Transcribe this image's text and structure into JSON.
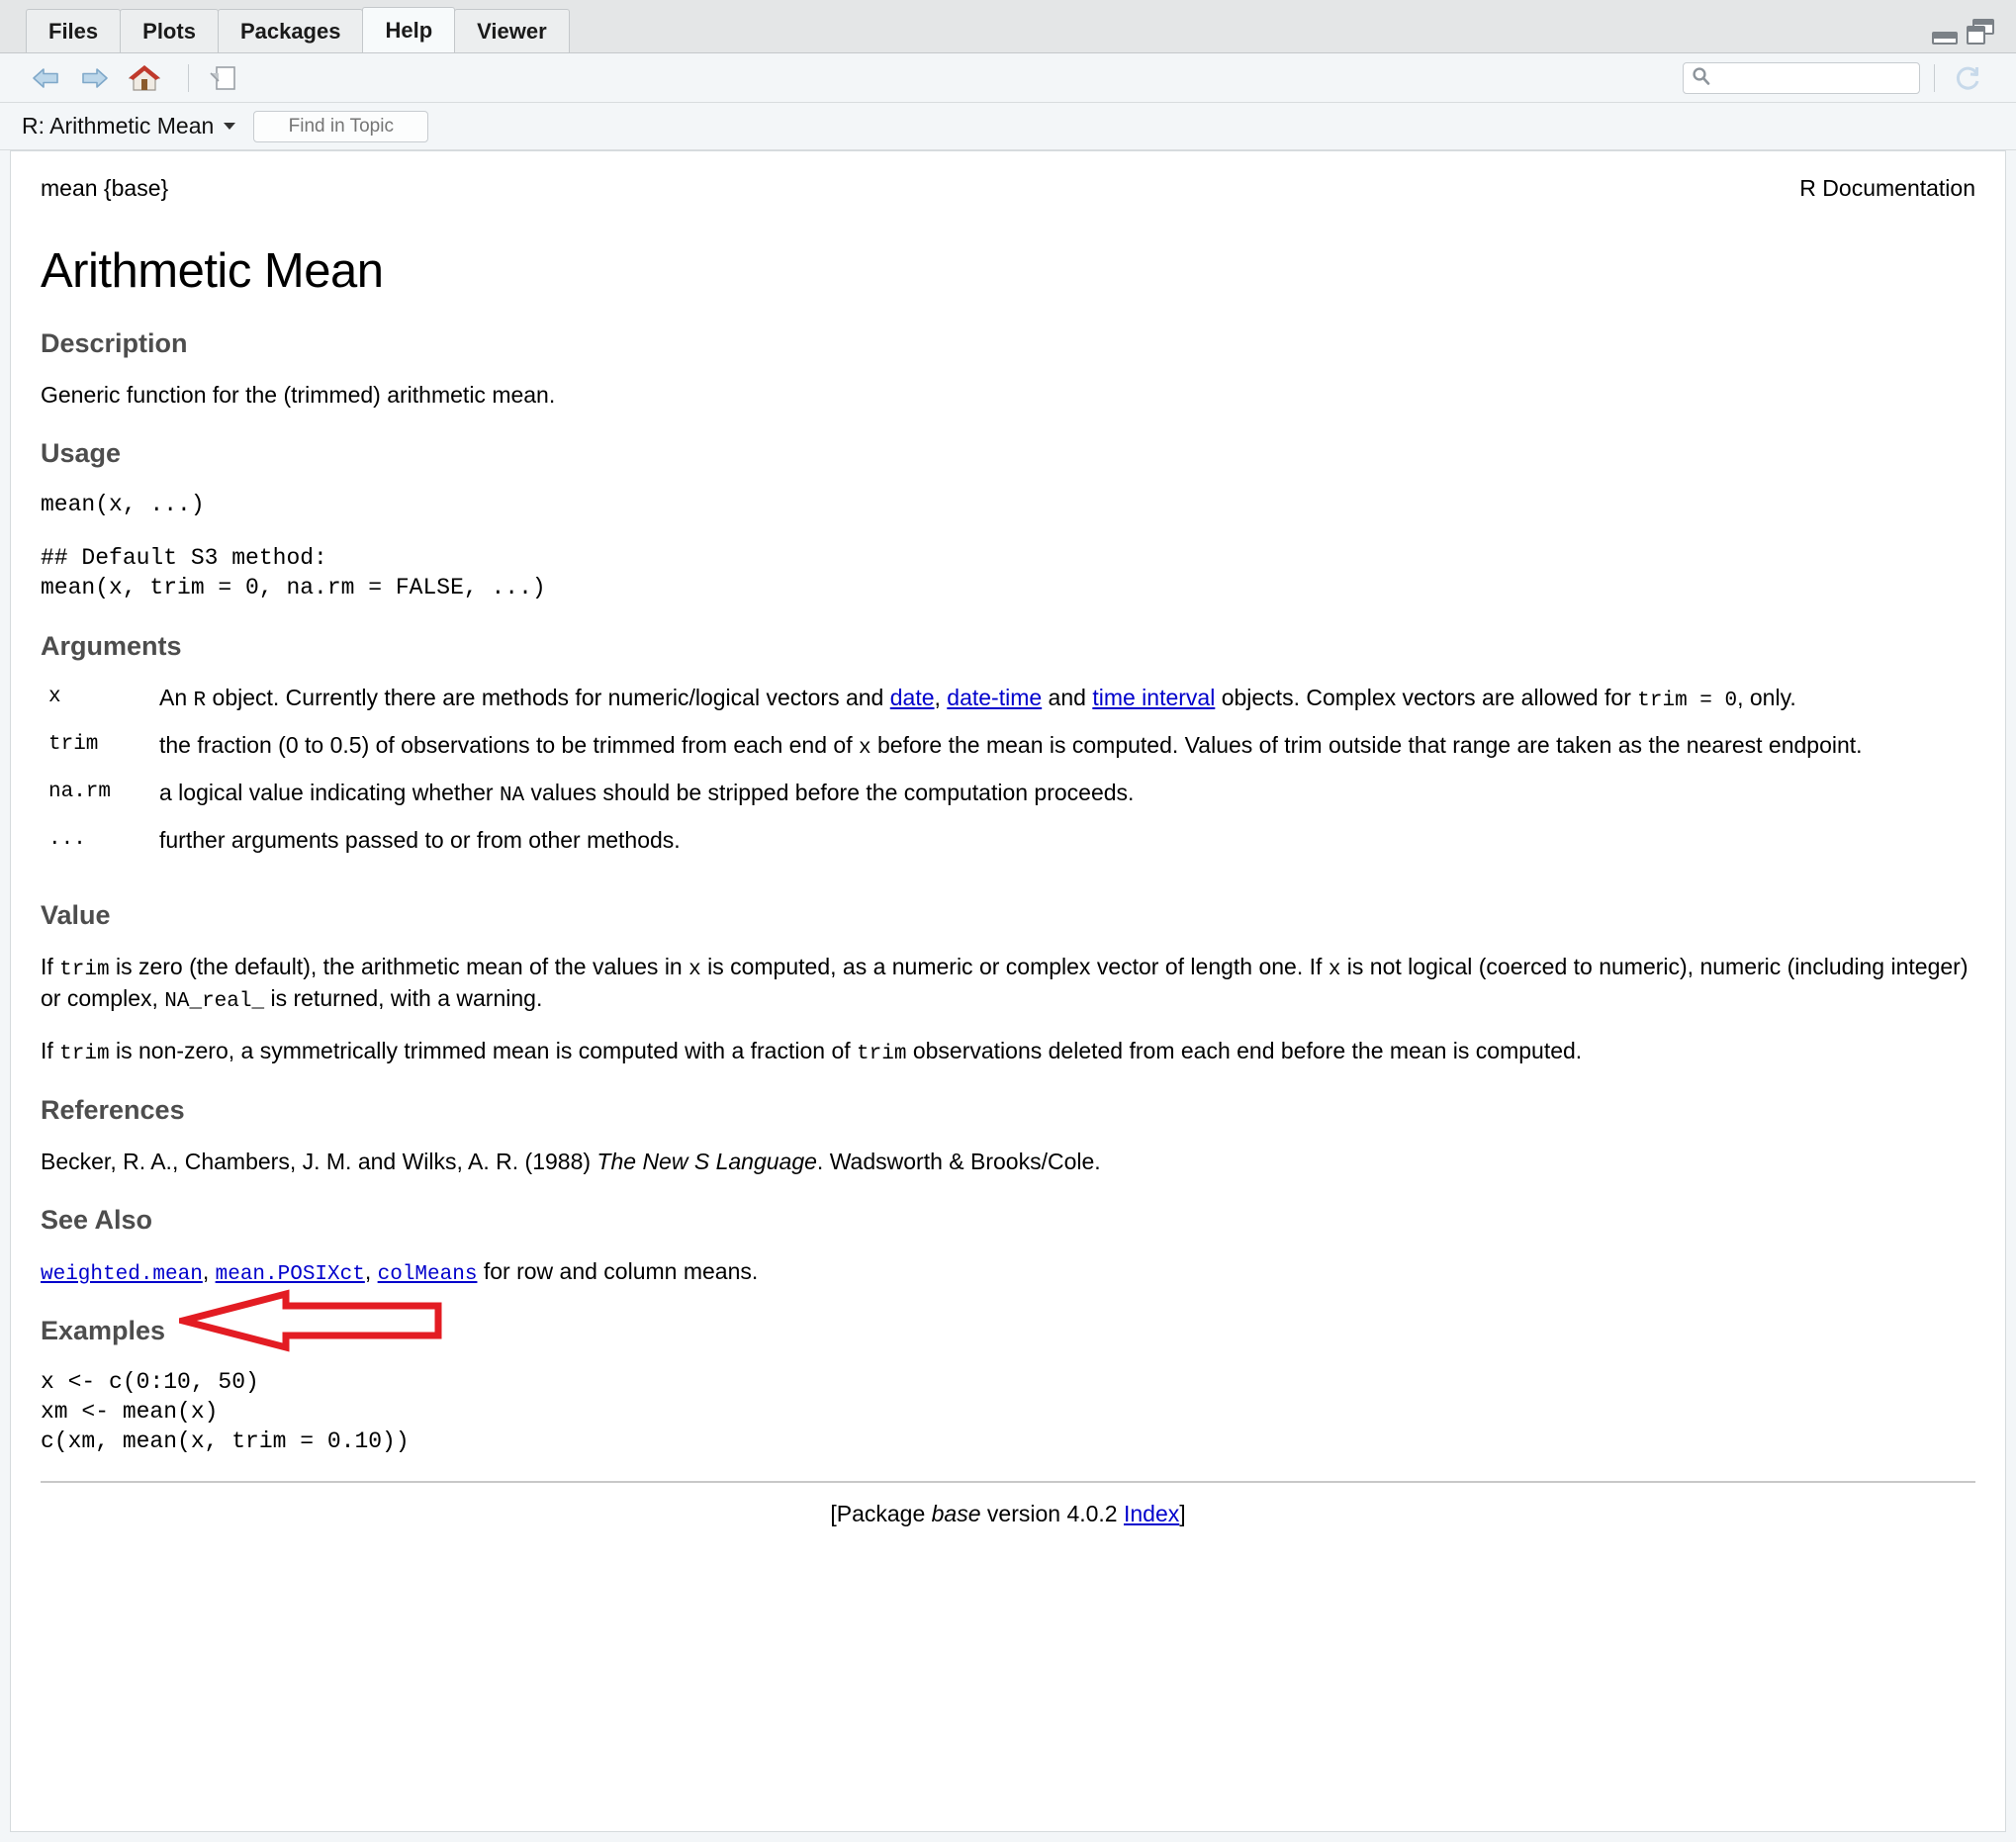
{
  "window": {
    "tabs": [
      {
        "label": "Files",
        "active": false
      },
      {
        "label": "Plots",
        "active": false
      },
      {
        "label": "Packages",
        "active": false
      },
      {
        "label": "Help",
        "active": true
      },
      {
        "label": "Viewer",
        "active": false
      }
    ],
    "controls": {
      "minimize": "minimize-icon",
      "maximize": "maximize-icon"
    }
  },
  "toolbar": {
    "back_icon": "back-arrow-icon",
    "forward_icon": "forward-arrow-icon",
    "home_icon": "home-icon",
    "popout_icon": "show-in-new-window-icon",
    "search_placeholder": "",
    "search_value": "",
    "search_icon": "search-icon",
    "refresh_icon": "refresh-icon"
  },
  "topicbar": {
    "title": "R: Arithmetic Mean",
    "dropdown_icon": "chevron-down-icon",
    "find_placeholder": "Find in Topic",
    "find_value": ""
  },
  "document": {
    "header_left": "mean {base}",
    "header_right": "R Documentation",
    "title": "Arithmetic Mean",
    "sections": {
      "description": {
        "heading": "Description",
        "text": "Generic function for the (trimmed) arithmetic mean."
      },
      "usage": {
        "heading": "Usage",
        "code_line_1": "mean(x, ...)",
        "code_comment": "## Default S3 method:",
        "code_line_2": "mean(x, trim = 0, na.rm = FALSE, ...)"
      },
      "arguments": {
        "heading": "Arguments",
        "rows": [
          {
            "name": "x",
            "parts": {
              "t1": "An ",
              "c1": "R",
              "t2": " object. Currently there are methods for numeric/logical vectors and ",
              "link1": "date",
              "t3": ", ",
              "link2": "date-time",
              "t4": " and ",
              "link3": "time interval",
              "t5": " objects. Complex vectors are allowed for ",
              "c2": "trim = 0",
              "t6": ", only."
            }
          },
          {
            "name": "trim",
            "parts": {
              "t1": "the fraction (0 to 0.5) of observations to be trimmed from each end of ",
              "c1": "x",
              "t2": " before the mean is computed. Values of trim outside that range are taken as the nearest endpoint."
            }
          },
          {
            "name": "na.rm",
            "parts": {
              "t1": "a logical value indicating whether ",
              "c1": "NA",
              "t2": " values should be stripped before the computation proceeds."
            }
          },
          {
            "name": "...",
            "parts": {
              "t1": "further arguments passed to or from other methods."
            }
          }
        ]
      },
      "value": {
        "heading": "Value",
        "p1": {
          "t1": "If ",
          "c1": "trim",
          "t2": " is zero (the default), the arithmetic mean of the values in ",
          "c2": "x",
          "t3": " is computed, as a numeric or complex vector of length one. If ",
          "c3": "x",
          "t4": " is not logical (coerced to numeric), numeric (including integer) or complex, ",
          "c4": "NA_real_",
          "t5": " is returned, with a warning."
        },
        "p2": {
          "t1": "If ",
          "c1": "trim",
          "t2": " is non-zero, a symmetrically trimmed mean is computed with a fraction of ",
          "c2": "trim",
          "t3": " observations deleted from each end before the mean is computed."
        }
      },
      "references": {
        "heading": "References",
        "p_pre": "Becker, R. A., Chambers, J. M. and Wilks, A. R. (1988) ",
        "p_italic": "The New S Language",
        "p_post": ". Wadsworth & Brooks/Cole."
      },
      "see_also": {
        "heading": "See Also",
        "link1": "weighted.mean",
        "sep1": ", ",
        "link2": "mean.POSIXct",
        "sep2": ", ",
        "link3": "colMeans",
        "tail": " for row and column means."
      },
      "examples": {
        "heading": "Examples",
        "code": "x <- c(0:10, 50)\nxm <- mean(x)\nc(xm, mean(x, trim = 0.10))"
      }
    },
    "footer": {
      "pre": "[Package ",
      "package": "base",
      "mid": " version 4.0.2 ",
      "link": "Index",
      "post": "]"
    }
  },
  "annotation": {
    "type": "arrow-left",
    "color": "#e31c23",
    "points_at": "Examples"
  }
}
